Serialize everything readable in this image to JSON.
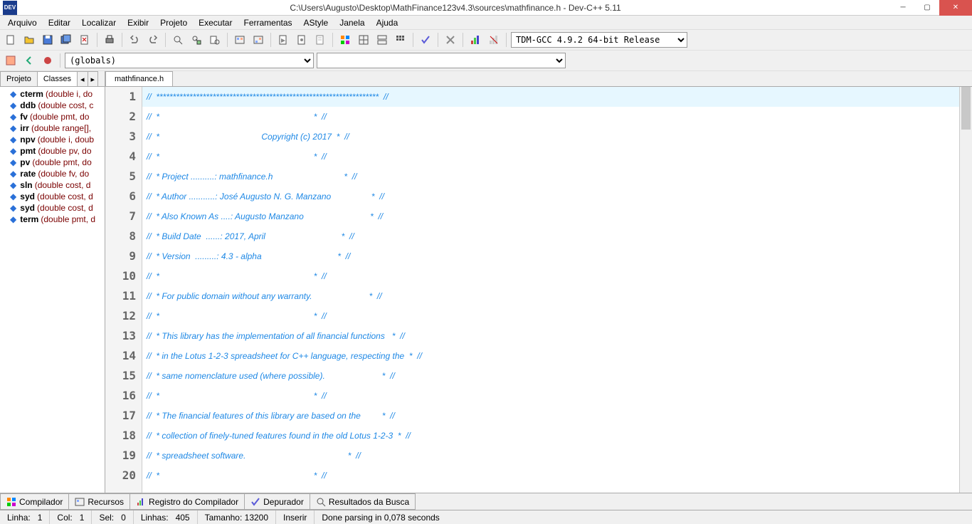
{
  "title": "C:\\Users\\Augusto\\Desktop\\MathFinance123v4.3\\sources\\mathfinance.h - Dev-C++ 5.11",
  "menu": [
    "Arquivo",
    "Editar",
    "Localizar",
    "Exibir",
    "Projeto",
    "Executar",
    "Ferramentas",
    "AStyle",
    "Janela",
    "Ajuda"
  ],
  "scope_combo": "(globals)",
  "compiler_combo": "TDM-GCC 4.9.2 64-bit Release",
  "left_tabs": {
    "projeto": "Projeto",
    "classes": "Classes"
  },
  "symbols": [
    {
      "name": "cterm",
      "sig": "(double i, do"
    },
    {
      "name": "ddb",
      "sig": "(double cost, c"
    },
    {
      "name": "fv",
      "sig": "(double pmt, do"
    },
    {
      "name": "irr",
      "sig": "(double range[],"
    },
    {
      "name": "npv",
      "sig": "(double i, doub"
    },
    {
      "name": "pmt",
      "sig": "(double pv, do"
    },
    {
      "name": "pv",
      "sig": "(double pmt, do"
    },
    {
      "name": "rate",
      "sig": "(double fv, do"
    },
    {
      "name": "sln",
      "sig": "(double cost, d"
    },
    {
      "name": "syd",
      "sig": "(double cost, d"
    },
    {
      "name": "syd",
      "sig": "(double cost, d"
    },
    {
      "name": "term",
      "sig": "(double pmt, d"
    }
  ],
  "doc_tab": "mathfinance.h",
  "code_lines": [
    "//  *******************************************************************  //",
    "//  *                                                                 *  //",
    "//  *                                           Copyright (c) 2017  *  //",
    "//  *                                                                 *  //",
    "//  * Project ..........: mathfinance.h                              *  //",
    "//  * Author ...........: José Augusto N. G. Manzano                 *  //",
    "//  * Also Known As ....: Augusto Manzano                            *  //",
    "//  * Build Date  ......: 2017, April                                *  //",
    "//  * Version  .........: 4.3 - alpha                                *  //",
    "//  *                                                                 *  //",
    "//  * For public domain without any warranty.                        *  //",
    "//  *                                                                 *  //",
    "//  * This library has the implementation of all financial functions   *  //",
    "//  * in the Lotus 1-2-3 spreadsheet for C++ language, respecting the  *  //",
    "//  * same nomenclature used (where possible).                        *  //",
    "//  *                                                                 *  //",
    "//  * The financial features of this library are based on the         *  //",
    "//  * collection of finely-tuned features found in the old Lotus 1-2-3  *  //",
    "//  * spreadsheet software.                                           *  //",
    "//  *                                                                 *  //"
  ],
  "bottom_tabs": {
    "compilador": "Compilador",
    "recursos": "Recursos",
    "registro": "Registro do Compilador",
    "depurador": "Depurador",
    "resultados": "Resultados da Busca"
  },
  "status": {
    "linha_label": "Linha:",
    "linha": "1",
    "col_label": "Col:",
    "col": "1",
    "sel_label": "Sel:",
    "sel": "0",
    "linhas_label": "Linhas:",
    "linhas": "405",
    "tam_label": "Tamanho:",
    "tam": "13200",
    "mode": "Inserir",
    "parse": "Done parsing in 0,078 seconds"
  }
}
